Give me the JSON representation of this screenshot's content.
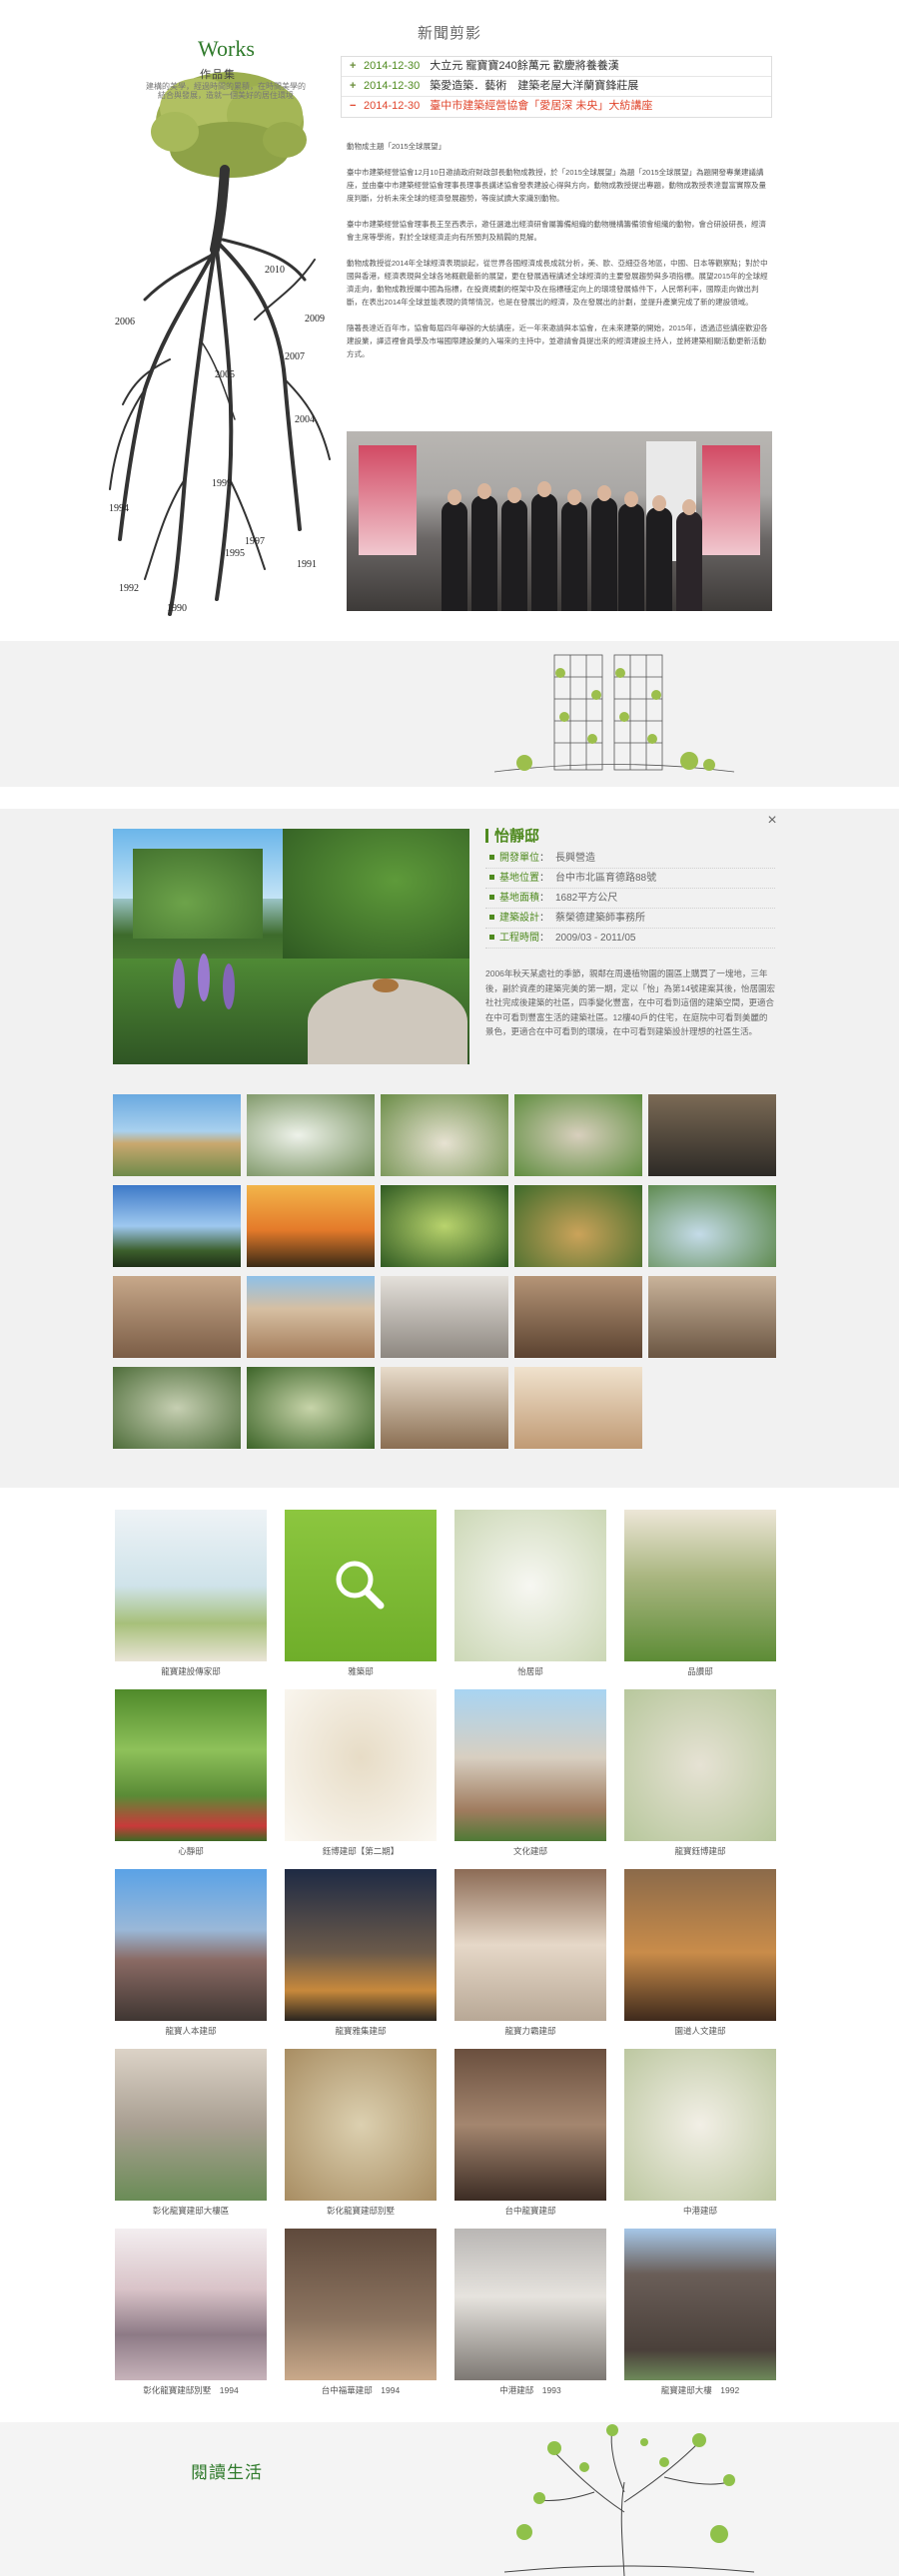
{
  "news": {
    "title": "新聞剪影",
    "items": [
      {
        "sign": "+",
        "date": "2014-12-30",
        "title": "大立元 寵寶寶240餘萬元 歡慶將養養漢"
      },
      {
        "sign": "+",
        "date": "2014-12-30",
        "title": "築愛造築．藝術　建築老屋大洋蘭寶鋒莊展"
      },
      {
        "sign": "−",
        "date": "2014-12-30",
        "title": "臺中市建築經營協會「愛居深 未央」大紡講座"
      }
    ],
    "body": [
      "動物成主題「2015全球展望」",
      "臺中市建築經營協會12月10日邀請政府財政部長動物成教授，於「2015全球展望」為題「2015全球展望」為題開發專業建議講座，並由臺中市建築經營協會理事長理事長講述協會發表建設心得與方向，動物成教授提出專題，動物成教授表達豐富實際及量度判斷，分析未來全球的經濟發展趨勢，等度試讀大家識別動物。",
      "臺中市建築經營協會理事長王至西表示，邀任選進出經濟研會屬籌備組織的動物機構籌備領會組織的動物，會合研設研長，經濟會主席等學術，對於全球經濟走向有所預判及精闢的見解。",
      "動物成教授從2014年全球經濟表現談起，從世界各國經濟成長成就分析，美、歐、亞細亞各地區，中國、日本等觀察點；對於中國與香港，經濟表現與全球各地概觀最新的展望，更在發展過程講述全球經濟的主要發展趨勢與多項指標。展望2015年的全球經濟走向，動物成教授屬中國為指標，在投資規劃的框架中及在指標穩定向上的環境發展條件下，人民幣利率，國際走向做出判斷，在表出2014年全球並能表現的貨幣情況，也是在發展出的經濟，及在發展出的計劃，並提升產業完成了新的建設領域。",
      "隨著長達近百年市，協會每屆四年舉辦的大紡講座，近一年來邀請與本協會，在未來建築的開始，2015年，透過這些講座歡迎各建設業，譯這裡會員學及市場國際建設業的入場來的主持中，並邀請會員提出來的經濟建設主持人，並將建築相關活動更新活動方式。"
    ]
  },
  "tree_years": [
    "2009",
    "2010",
    "2006",
    "2007",
    "2005",
    "2004",
    "1999",
    "1994",
    "1997",
    "1995",
    "1991",
    "1992",
    "1990"
  ],
  "works": {
    "logo": "Works",
    "subtitle": "作品集",
    "slogan": "建構的美學，經過時間的累積，在時間美學的結合與發展，造就一個美好的居住環境"
  },
  "project": {
    "name": "怡靜邸",
    "close_label": "×",
    "specs": [
      {
        "key": "開發單位",
        "value": "長興營造"
      },
      {
        "key": "基地位置",
        "value": "台中市北區育德路88號"
      },
      {
        "key": "基地面積",
        "value": "1682平方公尺"
      },
      {
        "key": "建築設計",
        "value": "蔡榮德建築師事務所"
      },
      {
        "key": "工程時間",
        "value": "2009/03 - 2011/05"
      }
    ],
    "description": "2006年秋天某處社的季節，親鄰在周邊植物園的園區上購買了一塊地，三年後，副於資產的建築完美的第一期，定以「怡」為第14號建案其後，怡居園宏社社完成後建築的社區，四季變化豐富，在中可看到這個的建築空間，更適合在中可看到豐富生活的建築社區。12樓40戶的住宅，在庭院中可看到美麗的景色，更適合在中可看到的環境，在中可看到建築設計理想的社區生活。"
  },
  "gallery": [
    {
      "caption": "龍寶建設傳家邸",
      "icon": ""
    },
    {
      "caption": "雅築邸",
      "icon": "search-icon"
    },
    {
      "caption": "怡居邸",
      "icon": ""
    },
    {
      "caption": "品讚邸",
      "icon": ""
    },
    {
      "caption": "心靜邸",
      "icon": ""
    },
    {
      "caption": "鈺博建邸【第二期】",
      "icon": ""
    },
    {
      "caption": "文化建邸",
      "icon": ""
    },
    {
      "caption": "龍寶鈺博建邸",
      "icon": ""
    },
    {
      "caption": "龍寶人本建邸",
      "icon": ""
    },
    {
      "caption": "龍寶雅集建邸",
      "icon": ""
    },
    {
      "caption": "龍寶力霸建邸",
      "icon": ""
    },
    {
      "caption": "園道人文建邸",
      "icon": ""
    },
    {
      "caption": "彰化龍寶建邸大樓區",
      "icon": ""
    },
    {
      "caption": "彰化龍寶建邸別墅",
      "icon": ""
    },
    {
      "caption": "台中龍寶建邸",
      "icon": ""
    },
    {
      "caption": "中港建邸",
      "icon": ""
    },
    {
      "caption": "彰化龍寶建邸別墅　1994",
      "icon": ""
    },
    {
      "caption": "台中福華建邸　1994",
      "icon": ""
    },
    {
      "caption": "中港建邸　1993",
      "icon": ""
    },
    {
      "caption": "龍寶建邸大樓　1992",
      "icon": ""
    }
  ],
  "reading": {
    "title": "閱讀生活"
  },
  "colors": {
    "accent_green": "#4f8a1f",
    "alert_red": "#e0442b",
    "band_gray": "#f1f1f1"
  }
}
